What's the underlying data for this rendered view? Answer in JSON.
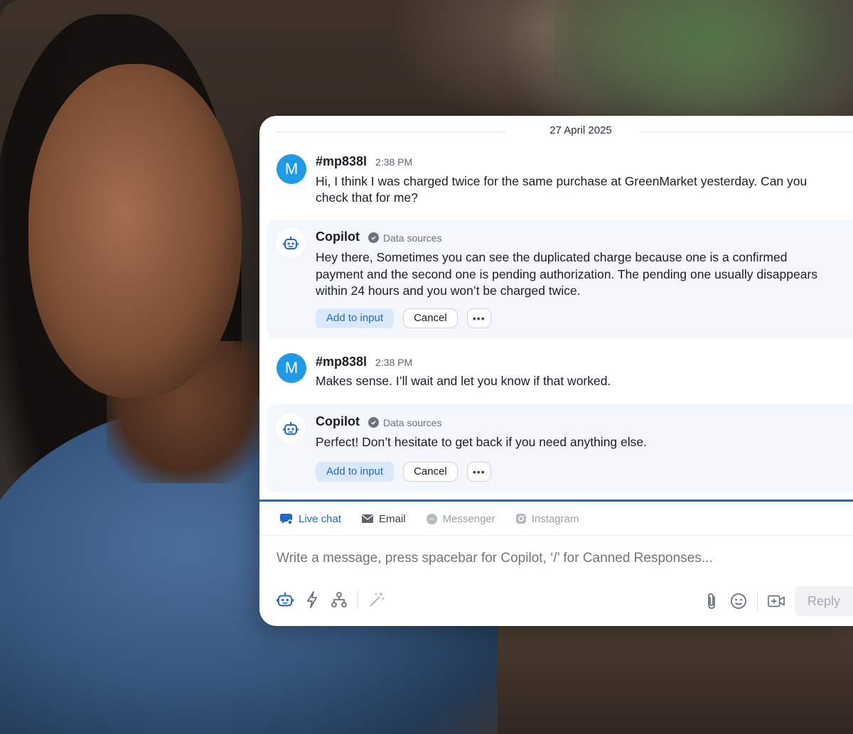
{
  "conversation": {
    "date": "27 April 2025",
    "messages": [
      {
        "type": "customer",
        "avatar_letter": "M",
        "sender": "#mp838l",
        "time": "2:38 PM",
        "text": "Hi, I think I was charged twice for the same purchase at GreenMarket yesterday. Can you check that for me?"
      },
      {
        "type": "copilot",
        "sender": "Copilot",
        "data_sources_label": "Data sources",
        "text": "Hey there, Sometimes you can see the duplicated charge because one is a confirmed payment and the second one is pending authorization. The pending one usually disappears within 24 hours and you won’t be charged twice.",
        "add_label": "Add to input",
        "cancel_label": "Cancel",
        "more_label": "•••"
      },
      {
        "type": "customer",
        "avatar_letter": "M",
        "sender": "#mp838l",
        "time": "2:38 PM",
        "text": "Makes sense. I’ll wait and let you know if that worked."
      },
      {
        "type": "copilot",
        "sender": "Copilot",
        "data_sources_label": "Data sources",
        "text": "Perfect! Don’t hesitate to get back if you need anything else.",
        "add_label": "Add to input",
        "cancel_label": "Cancel",
        "more_label": "•••"
      }
    ]
  },
  "composer": {
    "channels": [
      {
        "label": "Live chat",
        "icon": "chat-bubble-icon",
        "active": true
      },
      {
        "label": "Email",
        "icon": "envelope-icon",
        "active": false
      },
      {
        "label": "Messenger",
        "icon": "messenger-icon",
        "active": false
      },
      {
        "label": "Instagram",
        "icon": "instagram-icon",
        "active": false
      }
    ],
    "placeholder": "Write a message, press spacebar for Copilot, ‘/’ for Canned Responses...",
    "reply_label": "Reply"
  },
  "colors": {
    "accent": "#1f67d6",
    "avatar": "#1d9be8",
    "bot_bg": "#f3f6fb",
    "add_button_bg": "#d9e9fb"
  }
}
